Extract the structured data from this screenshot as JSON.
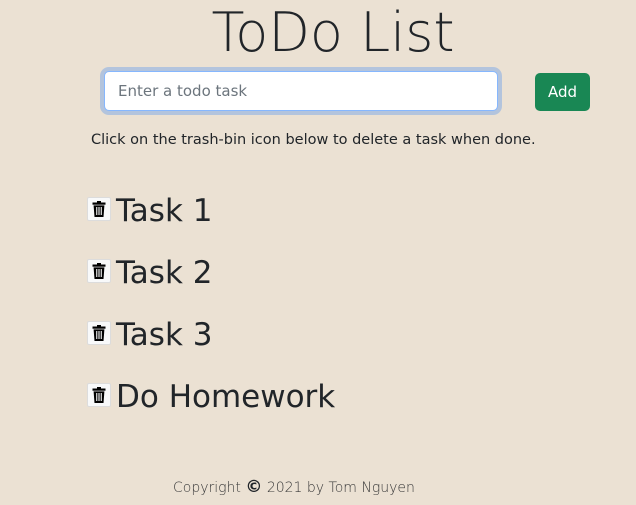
{
  "header": {
    "title": "ToDo List"
  },
  "form": {
    "input_placeholder": "Enter a todo task",
    "input_value": "",
    "add_label": "Add"
  },
  "hint": {
    "text": "Click on the trash-bin icon below to delete a task when done."
  },
  "tasks": [
    {
      "label": "Task 1",
      "icon": "trash-icon"
    },
    {
      "label": "Task 2",
      "icon": "trash-icon"
    },
    {
      "label": "Task 3",
      "icon": "trash-icon"
    },
    {
      "label": "Do Homework",
      "icon": "trash-icon"
    }
  ],
  "footer": {
    "prefix": "Copyright",
    "symbol": "©",
    "suffix": "2021 by Tom Nguyen"
  },
  "colors": {
    "background": "#ebe1d3",
    "add_button": "#198754",
    "focus_ring": "#86b7fe"
  }
}
